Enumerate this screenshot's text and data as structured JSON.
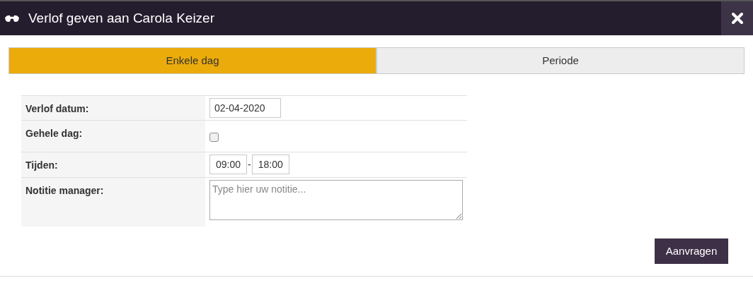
{
  "window": {
    "title": "Verlof geven aan Carola Keizer"
  },
  "tabs": [
    {
      "label": "Enkele dag",
      "selected": true
    },
    {
      "label": "Periode",
      "selected": false
    }
  ],
  "fields": [
    {
      "kind": "text",
      "label": "Verlof datum:",
      "value": "02-04-2020"
    },
    {
      "kind": "checkbox",
      "label": "Gehele dag:",
      "checked": false
    },
    {
      "kind": "timerange",
      "label": "Tijden:",
      "from": "09:00",
      "separator": "-",
      "to": "18:00"
    },
    {
      "kind": "textarea",
      "label": "Notitie manager:",
      "placeholder": "Type hier uw notitie..."
    }
  ],
  "submit_button": "Aanvragen"
}
